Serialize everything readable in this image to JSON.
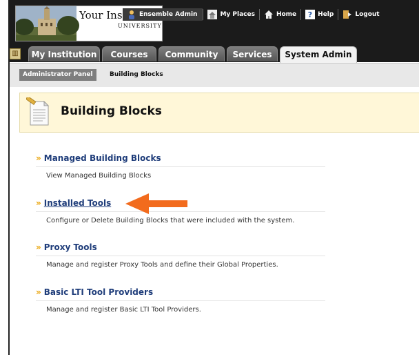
{
  "header": {
    "logo_name": "Your Institution",
    "logo_sub": "UNIVERSITY",
    "links": [
      {
        "label": "Ensemble Admin",
        "icon": "user-icon"
      },
      {
        "label": "My Places",
        "icon": "places-icon"
      },
      {
        "label": "Home",
        "icon": "home-icon"
      },
      {
        "label": "Help",
        "icon": "help-icon"
      },
      {
        "label": "Logout",
        "icon": "logout-icon"
      }
    ]
  },
  "tabs": [
    {
      "label": "My Institution"
    },
    {
      "label": "Courses"
    },
    {
      "label": "Community"
    },
    {
      "label": "Services"
    },
    {
      "label": "System Admin",
      "active": true
    }
  ],
  "breadcrumb": {
    "panel": "Administrator Panel",
    "current": "Building Blocks"
  },
  "page": {
    "title": "Building Blocks"
  },
  "items": [
    {
      "title": "Managed Building Blocks",
      "desc": "View Managed Building Blocks"
    },
    {
      "title": "Installed Tools",
      "desc": "Configure or Delete Building Blocks that were included with the system."
    },
    {
      "title": "Proxy Tools",
      "desc": "Manage and register Proxy Tools and define their Global Properties."
    },
    {
      "title": "Basic LTI Tool Providers",
      "desc": "Manage and register Basic LTI Tool Providers."
    }
  ],
  "colors": {
    "header_bg": "#1b1b1b",
    "link_blue": "#1f3d7a",
    "title_band": "#fff7d8",
    "arrow": "#f26b1d"
  }
}
